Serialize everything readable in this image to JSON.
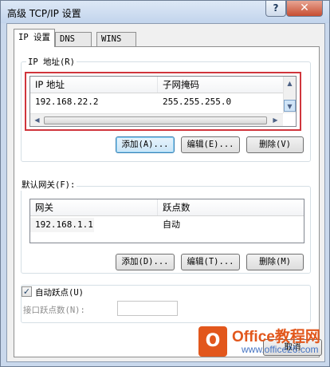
{
  "window": {
    "title": "高级 TCP/IP 设置",
    "help_label": "?",
    "close_label": "✕"
  },
  "tabs": [
    {
      "label": "IP 设置"
    },
    {
      "label": "DNS"
    },
    {
      "label": "WINS"
    }
  ],
  "ip_group": {
    "label": "IP 地址(R)",
    "columns": [
      "IP 地址",
      "子网掩码"
    ],
    "rows": [
      {
        "ip": "192.168.22.2",
        "mask": "255.255.255.0"
      }
    ],
    "buttons": {
      "add": "添加(A)...",
      "edit": "编辑(E)...",
      "delete": "删除(V)"
    }
  },
  "gateway_group": {
    "label": "默认网关(F):",
    "columns": [
      "网关",
      "跃点数"
    ],
    "rows": [
      {
        "gateway": "192.168.1.1",
        "metric": "自动"
      }
    ],
    "buttons": {
      "add": "添加(D)...",
      "edit": "编辑(T)...",
      "delete": "删除(M)"
    }
  },
  "auto_metric": {
    "label": "自动跃点(U)",
    "checked": true,
    "check_glyph": "✓"
  },
  "interface_metric": {
    "label": "接口跃点数(N):",
    "value": ""
  },
  "bottom_buttons": {
    "cancel": "取消"
  },
  "watermark": {
    "logo": "O",
    "title": "Office教程网",
    "url": "www.office26.com"
  },
  "colors": {
    "highlight": "#d0353c",
    "brand": "#e2571c"
  }
}
